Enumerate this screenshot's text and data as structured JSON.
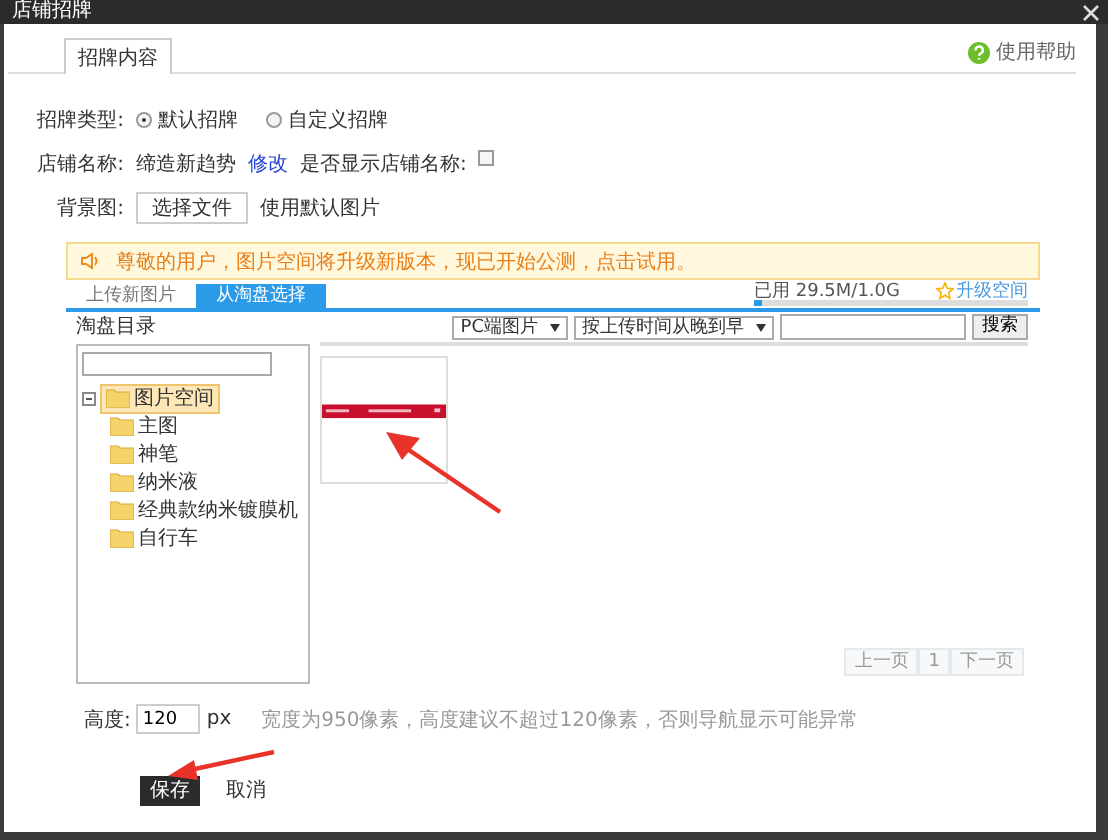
{
  "window": {
    "title": "店铺招牌"
  },
  "tabs": [
    {
      "label": "招牌内容",
      "selected": true
    }
  ],
  "help": {
    "label": "使用帮助"
  },
  "sign_type": {
    "label": "招牌类型:",
    "options": [
      {
        "label": "默认招牌",
        "selected": true
      },
      {
        "label": "自定义招牌",
        "selected": false
      }
    ]
  },
  "shop_name": {
    "label": "店铺名称:",
    "value": "缔造新趋势",
    "edit_link": "修改",
    "show_label": "是否显示店铺名称:",
    "show_checked": false
  },
  "background": {
    "label": "背景图:",
    "button": "选择文件",
    "note": "使用默认图片"
  },
  "notice": "尊敬的用户，图片空间将升级新版本，现已开始公测，点击试用。",
  "picker_tabs": [
    {
      "label": "上传新图片",
      "selected": false
    },
    {
      "label": "从淘盘选择",
      "selected": true
    }
  ],
  "storage": {
    "reading": "已用 29.5M/1.0G",
    "level": 0.03,
    "upgrade": "升级空间"
  },
  "directory_title": "淘盘目录",
  "filters": {
    "source": "PC端图片",
    "sort": "按上传时间从晚到早",
    "search_button": "搜索"
  },
  "tree": [
    {
      "label": "图片空间",
      "expanded": true,
      "selected": true,
      "children": [
        {
          "label": "主图",
          "selected": false
        },
        {
          "label": "神笔",
          "selected": false
        },
        {
          "label": "纳米液",
          "selected": false
        },
        {
          "label": "经典款纳米镀膜机",
          "selected": false
        },
        {
          "label": "自行车",
          "selected": false
        }
      ]
    }
  ],
  "pagination": {
    "prev": "上一页",
    "page": "1",
    "next": "下一页"
  },
  "height": {
    "label": "高度:",
    "value": "120",
    "unit": "px",
    "hint": "宽度为950像素，高度建议不超过120像素，否则导航显示可能异常"
  },
  "buttons": [
    {
      "label": "保存",
      "kind": "primary"
    },
    {
      "label": "取消",
      "kind": "plain"
    }
  ]
}
